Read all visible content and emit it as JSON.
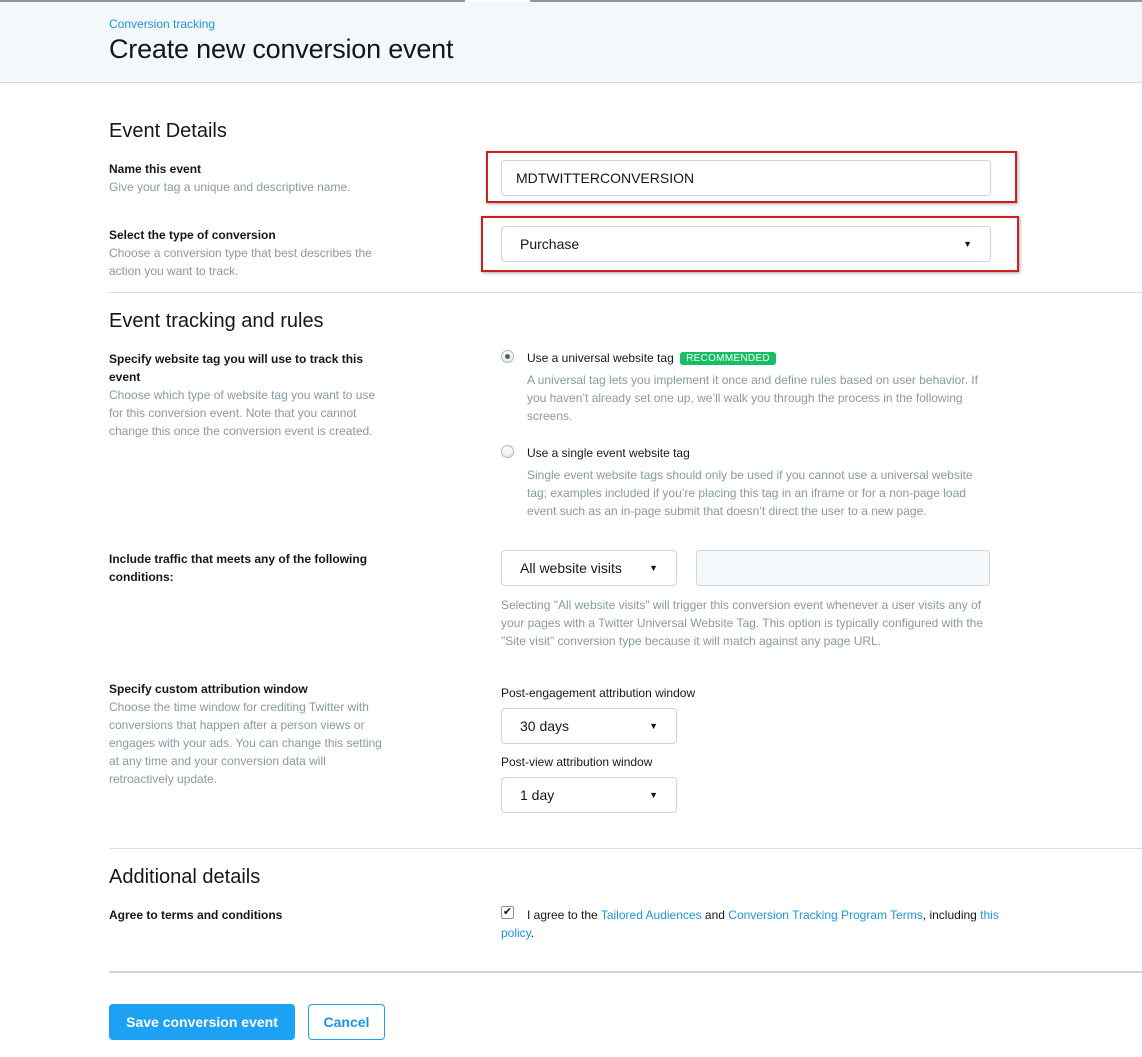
{
  "header": {
    "breadcrumb": "Conversion tracking",
    "title": "Create new conversion event"
  },
  "event_details": {
    "section_title": "Event Details",
    "name_label": "Name this event",
    "name_help": "Give your tag a unique and descriptive name.",
    "name_value": "MDTWITTERCONVERSION",
    "type_label": "Select the type of conversion",
    "type_help": "Choose a conversion type that best describes the action you want to track.",
    "type_value": "Purchase"
  },
  "tracking": {
    "section_title": "Event tracking and rules",
    "tag_label": "Specify website tag you will use to track this event",
    "tag_help": "Choose which type of website tag you want to use for this conversion event. Note that you cannot change this once the conversion event is created.",
    "options": [
      {
        "label": "Use a universal website tag",
        "badge": "RECOMMENDED",
        "help": "A universal tag lets you implement it once and define rules based on user behavior. If you haven’t already set one up, we’ll walk you through the process in the following screens.",
        "selected": true
      },
      {
        "label": "Use a single event website tag",
        "help": "Single event website tags should only be used if you cannot use a universal website tag; examples included if you’re placing this tag in an iframe or for a non-page load event such as an in-page submit that doesn’t direct the user to a new page.",
        "selected": false
      }
    ],
    "traffic_label": "Include traffic that meets any of the following conditions:",
    "traffic_value": "All website visits",
    "traffic_help": "Selecting \"All website visits\" will trigger this conversion event whenever a user visits any of your pages with a Twitter Universal Website Tag. This option is typically configured with the \"Site visit\" conversion type because it will match against any page URL.",
    "attribution_label": "Specify custom attribution window",
    "attribution_help": "Choose the time window for crediting Twitter with conversions that happen after a person views or engages with your ads. You can change this setting at any time and your conversion data will retroactively update.",
    "post_engagement_label": "Post-engagement attribution window",
    "post_engagement_value": "30 days",
    "post_view_label": "Post-view attribution window",
    "post_view_value": "1 day"
  },
  "additional": {
    "section_title": "Additional details",
    "terms_label": "Agree to terms and conditions",
    "terms_prefix": "I agree to the ",
    "terms_link1": "Tailored Audiences",
    "terms_mid": " and ",
    "terms_link2": "Conversion Tracking Program Terms",
    "terms_after": ", including ",
    "terms_link3": "this policy",
    "terms_suffix": ".",
    "checked": true
  },
  "actions": {
    "save_label": "Save conversion event",
    "cancel_label": "Cancel"
  },
  "colors": {
    "accent": "#1da1f2",
    "badge": "#17bf63",
    "highlight": "#cc1f1f"
  }
}
